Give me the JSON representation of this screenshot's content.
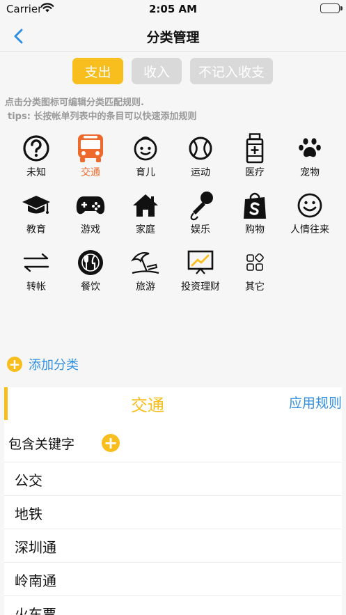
{
  "status_bar": {
    "carrier": "Carrier",
    "time": "2:05 AM"
  },
  "nav": {
    "title": "分类管理",
    "back_icon": "chevron-left-icon"
  },
  "segments": {
    "expense": "支出",
    "income": "收入",
    "excluded": "不记入收支",
    "selected": "expense"
  },
  "hints": {
    "line1": "点击分类图标可编辑分类匹配规则.",
    "line2": "tips: 长按帐单列表中的条目可以快速添加规则"
  },
  "categories": [
    {
      "label": "未知",
      "icon": "question-circle-icon"
    },
    {
      "label": "交通",
      "icon": "bus-icon",
      "selected": true
    },
    {
      "label": "育儿",
      "icon": "baby-face-icon"
    },
    {
      "label": "运动",
      "icon": "tennis-ball-icon"
    },
    {
      "label": "医疗",
      "icon": "medicine-bottle-icon"
    },
    {
      "label": "宠物",
      "icon": "paw-icon"
    },
    {
      "label": "教育",
      "icon": "graduation-cap-icon"
    },
    {
      "label": "游戏",
      "icon": "gamepad-icon"
    },
    {
      "label": "家庭",
      "icon": "home-icon"
    },
    {
      "label": "娱乐",
      "icon": "microphone-icon"
    },
    {
      "label": "购物",
      "icon": "shopping-bag-icon"
    },
    {
      "label": "人情往来",
      "icon": "smile-icon"
    },
    {
      "label": "转帐",
      "icon": "transfer-arrows-icon"
    },
    {
      "label": "餐饮",
      "icon": "dining-icon"
    },
    {
      "label": "旅游",
      "icon": "beach-umbrella-icon"
    },
    {
      "label": "投资理财",
      "icon": "investment-chart-icon"
    },
    {
      "label": "其它",
      "icon": "apps-grid-icon"
    }
  ],
  "add_category": "添加分类",
  "panel": {
    "title": "交通",
    "apply": "应用规则",
    "keywords_header": "包含关键字",
    "keywords": [
      "公交",
      "地铁",
      "深圳通",
      "岭南通",
      "火车票"
    ]
  },
  "colors": {
    "accent": "#f7be1e",
    "link": "#2f8fe0",
    "selected_label": "#ee6a2c"
  }
}
